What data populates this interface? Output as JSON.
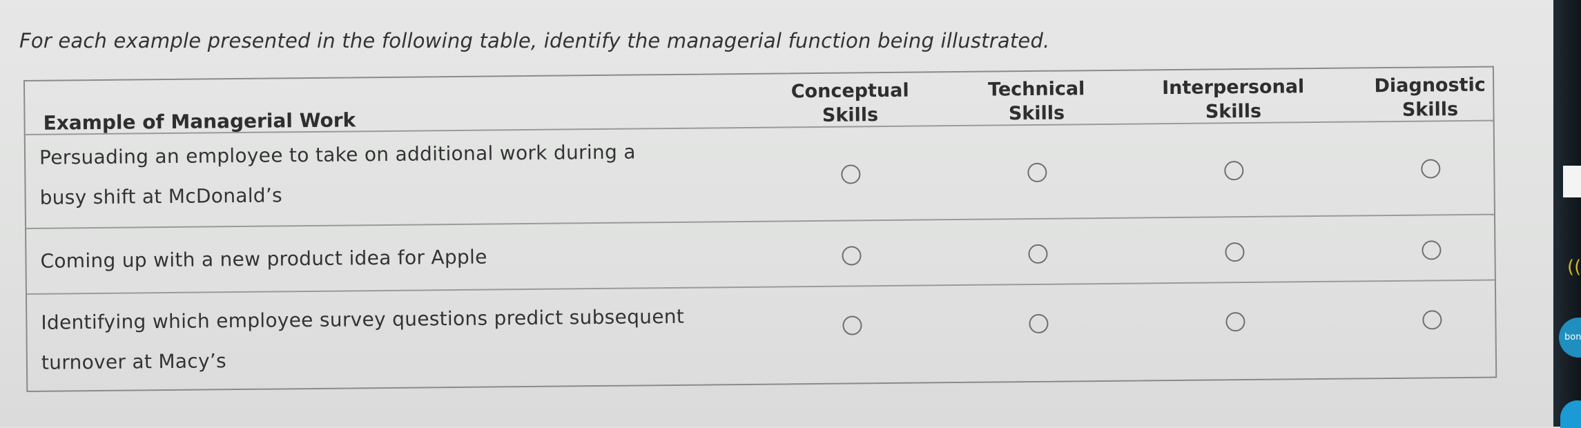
{
  "instruction": "For each example presented in the following table, identify the managerial function being illustrated.",
  "table": {
    "row_header": "Example of Managerial Work",
    "columns": [
      {
        "line1": "Conceptual",
        "line2": "Skills"
      },
      {
        "line1": "Technical",
        "line2": "Skills"
      },
      {
        "line1": "Interpersonal",
        "line2": "Skills"
      },
      {
        "line1": "Diagnostic",
        "line2": "Skills"
      }
    ],
    "rows": [
      {
        "line1": "Persuading an employee to take on additional work during a",
        "line2": "busy shift at McDonald’s"
      },
      {
        "line1": "Coming up with a new product idea for Apple",
        "line2": ""
      },
      {
        "line1": "Identifying which employee survey questions predict subsequent",
        "line2": "turnover at Macy’s"
      }
    ]
  },
  "sidebar": {
    "wifi_icon": "((",
    "badge_text": "bon"
  }
}
